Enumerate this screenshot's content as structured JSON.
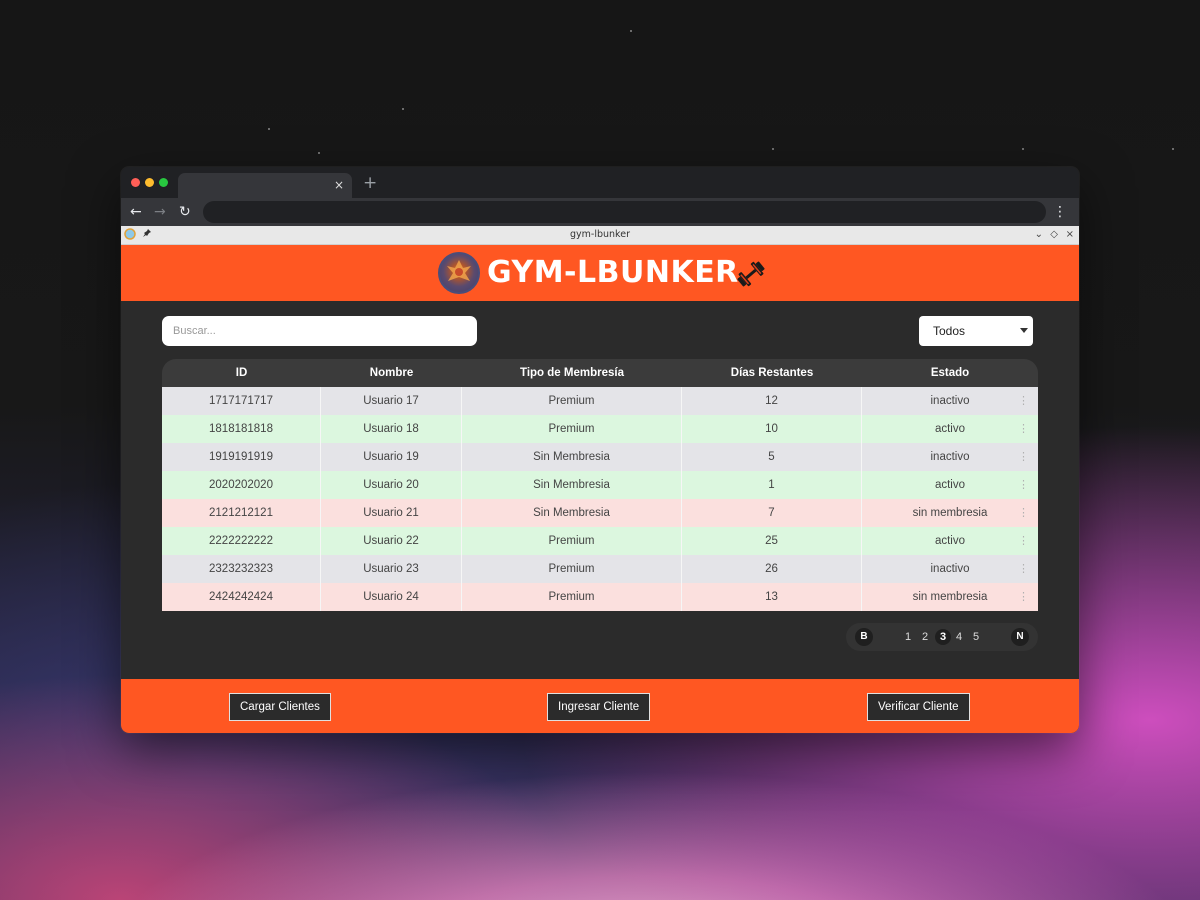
{
  "browser": {
    "tab_close": "×",
    "new_tab": "+",
    "nav_back": "←",
    "nav_forward": "→",
    "nav_reload": "↻",
    "menu": "⋮"
  },
  "app_window": {
    "title": "gym-lbunker",
    "controls": {
      "minimize": "⌄",
      "restore": "◇",
      "close": "×"
    }
  },
  "header": {
    "brand": "GYM-LBUNKER"
  },
  "search": {
    "placeholder": "Buscar..."
  },
  "filter": {
    "selected": "Todos"
  },
  "table": {
    "columns": [
      "ID",
      "Nombre",
      "Tipo de Membresía",
      "Días Restantes",
      "Estado"
    ],
    "rows": [
      {
        "id": "1717171717",
        "nombre": "Usuario 17",
        "tipo": "Premium",
        "dias": "12",
        "estado": "inactivo",
        "tone": "gray"
      },
      {
        "id": "1818181818",
        "nombre": "Usuario 18",
        "tipo": "Premium",
        "dias": "10",
        "estado": "activo",
        "tone": "green"
      },
      {
        "id": "1919191919",
        "nombre": "Usuario 19",
        "tipo": "Sin Membresia",
        "dias": "5",
        "estado": "inactivo",
        "tone": "gray"
      },
      {
        "id": "2020202020",
        "nombre": "Usuario 20",
        "tipo": "Sin Membresia",
        "dias": "1",
        "estado": "activo",
        "tone": "green"
      },
      {
        "id": "2121212121",
        "nombre": "Usuario 21",
        "tipo": "Sin Membresia",
        "dias": "7",
        "estado": "sin membresia",
        "tone": "red"
      },
      {
        "id": "2222222222",
        "nombre": "Usuario 22",
        "tipo": "Premium",
        "dias": "25",
        "estado": "activo",
        "tone": "green"
      },
      {
        "id": "2323232323",
        "nombre": "Usuario 23",
        "tipo": "Premium",
        "dias": "26",
        "estado": "inactivo",
        "tone": "gray"
      },
      {
        "id": "2424242424",
        "nombre": "Usuario 24",
        "tipo": "Premium",
        "dias": "13",
        "estado": "sin membresia",
        "tone": "red"
      }
    ],
    "row_menu": "⋮"
  },
  "pagination": {
    "back": "B",
    "next": "N",
    "pages": [
      "1",
      "2",
      "3",
      "4",
      "5"
    ],
    "current": "3"
  },
  "footer": {
    "load_label": "Cargar Clientes",
    "add_label": "Ingresar Cliente",
    "verify_label": "Verificar Cliente"
  },
  "colors": {
    "accent": "#ff5722",
    "row_gray": "#e4e4e8",
    "row_green": "#dcf7df",
    "row_red": "#fbe0de",
    "app_bg": "#2b2b2b"
  },
  "icons": {
    "logo": "gym-logo-icon",
    "dumbbell": "dumbbell-icon",
    "app": "app-icon",
    "pin": "pin-icon"
  }
}
